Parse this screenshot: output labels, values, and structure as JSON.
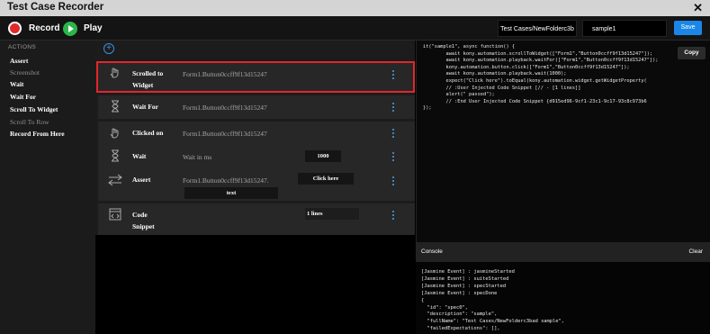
{
  "window": {
    "title": "Test Case Recorder",
    "close_glyph": "✕"
  },
  "toolbar": {
    "record_label": "Record",
    "play_label": "Play",
    "path_value": "Test Cases/NewFolderc3b",
    "name_value": "sample1",
    "save_label": "Save",
    "colors": {
      "record": "#e12929",
      "play": "#2bb54a",
      "save": "#1a87e8"
    }
  },
  "sidebar": {
    "heading": "ACTIONS",
    "items": [
      {
        "label": "Assert",
        "enabled": true
      },
      {
        "label": "Screenshot",
        "enabled": false
      },
      {
        "label": "Wait",
        "enabled": true
      },
      {
        "label": "Wait For",
        "enabled": true
      },
      {
        "label": "Scroll To Widget",
        "enabled": true
      },
      {
        "label": "Scroll To Row",
        "enabled": false
      },
      {
        "label": "Record From Here",
        "enabled": true
      }
    ]
  },
  "steps": {
    "add_glyph": "+",
    "items": [
      {
        "icon": "hand-pointer-icon",
        "action": "Scrolled to",
        "action2": "Widget",
        "target": "Form1.Button0ccff9f13d15247"
      },
      {
        "icon": "hourglass-icon",
        "action": "Wait For",
        "target": "Form1.Button0ccff9f13d15247"
      },
      {
        "icon": "hand-pointer-icon",
        "action": "Clicked on",
        "target": "Form1.Button0ccff9f13d15247"
      },
      {
        "icon": "hourglass-icon",
        "action": "Wait",
        "placeholder": "Wait in ms",
        "value": "1000"
      },
      {
        "icon": "arrows-icon",
        "action": "Assert",
        "target": "Form1.Button0ccff9f13d15247.",
        "value": "Click here",
        "value2": "text"
      },
      {
        "icon": "code-icon",
        "action": "Code",
        "action2": "Snippet",
        "value": "1 lines"
      }
    ],
    "highlight_color": "#e3262c"
  },
  "code": {
    "copy_label": "Copy",
    "text": "it(\"sample1\", async function() {\n        await kony.automation.scrollToWidget([\"Form1\",\"Button0ccff9f13d15247\"]);\n        await kony.automation.playback.waitFor([\"Form1\",\"Button0ccff9f13d15247\"]);\n        kony.automation.button.click([\"Form1\",\"Button0ccff9f13d15247\"]);\n        await kony.automation.playback.wait(1000);\n        expect(\"Click here\").toEqual(kony.automation.widget.getWidgetProperty(\n        // :User Injected Code Snippet [// - [1 lines]]\n        alert(\" passed\");\n        // :End User Injected Code Snippet {d915ed96-9cf1-23c1-9c17-93c8c973b6\n});"
  },
  "console": {
    "label": "Console",
    "clear_label": "Clear",
    "text": "[Jasmine Event] : jasmineStarted\n[Jasmine Event] : suiteStarted\n[Jasmine Event] : specStarted\n[Jasmine Event] : specDone\n{\n  \"id\": \"spec0\",\n  \"description\": \"sample\",\n  \"fullName\": \"Test Cases/NewFolderc3bad sample\",\n  \"failedExpectations\": [],"
  }
}
